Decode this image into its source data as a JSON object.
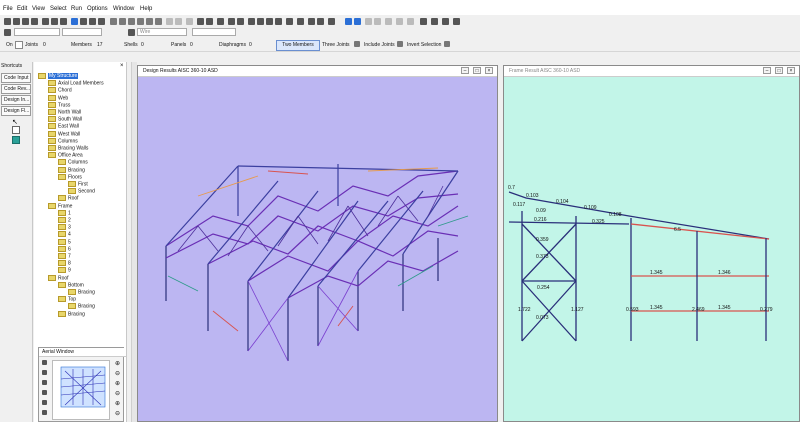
{
  "menu": [
    "File",
    "Edit",
    "View",
    "Select",
    "Run",
    "Options",
    "Window",
    "Help"
  ],
  "toolbar2": {
    "combo1": "",
    "combo2": "",
    "combo3": "Wire",
    "combo4": ""
  },
  "status": {
    "on_label": "On",
    "joints_label": "Joints",
    "joints_value": "0",
    "members_label": "Members",
    "members_value": "17",
    "shells_label": "Shells",
    "shells_value": "0",
    "panels_label": "Panels",
    "panels_value": "0",
    "diaphragms_label": "Diaphragms",
    "diaphragms_value": "0",
    "two_members": "Two Members",
    "three_joints": "Three Joints",
    "include_joints": "Include Joints",
    "invert_selection": "Invert Selection"
  },
  "shortcuts": {
    "title": "Shortcuts",
    "buttons": [
      "Code Input",
      "Code Rev...",
      "Design In...",
      "Design Fl..."
    ]
  },
  "tree": {
    "items": [
      {
        "label": "My Structure",
        "level": 0,
        "selected": true
      },
      {
        "label": "Axial Load Members",
        "level": 1
      },
      {
        "label": "Chord",
        "level": 1
      },
      {
        "label": "Web",
        "level": 1
      },
      {
        "label": "Truss",
        "level": 1
      },
      {
        "label": "North Wall",
        "level": 1
      },
      {
        "label": "South Wall",
        "level": 1
      },
      {
        "label": "East Wall",
        "level": 1
      },
      {
        "label": "West Wall",
        "level": 1
      },
      {
        "label": "Columns",
        "level": 1
      },
      {
        "label": "Bracing Walls",
        "level": 1
      },
      {
        "label": "Office Area",
        "level": 1
      },
      {
        "label": "Columns",
        "level": 2
      },
      {
        "label": "Bracing",
        "level": 2
      },
      {
        "label": "Floors",
        "level": 2
      },
      {
        "label": "First",
        "level": 3
      },
      {
        "label": "Second",
        "level": 3
      },
      {
        "label": "Roof",
        "level": 2
      },
      {
        "label": "Frame",
        "level": 1
      },
      {
        "label": "1",
        "level": 2
      },
      {
        "label": "2",
        "level": 2
      },
      {
        "label": "3",
        "level": 2
      },
      {
        "label": "4",
        "level": 2
      },
      {
        "label": "5",
        "level": 2
      },
      {
        "label": "6",
        "level": 2
      },
      {
        "label": "7",
        "level": 2
      },
      {
        "label": "8",
        "level": 2
      },
      {
        "label": "9",
        "level": 2
      },
      {
        "label": "Roof",
        "level": 1
      },
      {
        "label": "Bottom",
        "level": 2
      },
      {
        "label": "Bracing",
        "level": 3
      },
      {
        "label": "Top",
        "level": 2
      },
      {
        "label": "Bracing",
        "level": 3
      },
      {
        "label": "Bracing",
        "level": 2
      }
    ]
  },
  "aerial": {
    "title": "Aerial Window"
  },
  "left_window": {
    "title": "Design Results AISC 360-10 ASD"
  },
  "right_window": {
    "title": "Frame Result AISC 360-10 ASD"
  },
  "ratios": {
    "top_chord": [
      "0.103",
      "0.104",
      "0.109",
      "0.108"
    ],
    "mid_row": [
      "0.216",
      "0.325"
    ],
    "slanted": [
      "0.7",
      "0.117",
      "0.09",
      "0.359",
      "0.373",
      "0.073"
    ],
    "middle_horizontal": "0.254",
    "verticals": [
      "1.722",
      "1.127",
      "0.593",
      "2.469",
      "0.279"
    ],
    "right_top": "6.5",
    "beams_upper": [
      "1.345",
      "1.346"
    ],
    "beams_lower": [
      "1.345",
      "1.345"
    ]
  },
  "colors": {
    "left_bg": "#bcb6f2",
    "right_bg": "#c2f5e8",
    "member_navy": "#2a2f7a",
    "member_purple": "#6a2fb5",
    "member_red": "#d9534f",
    "member_orange": "#e79a4a"
  }
}
